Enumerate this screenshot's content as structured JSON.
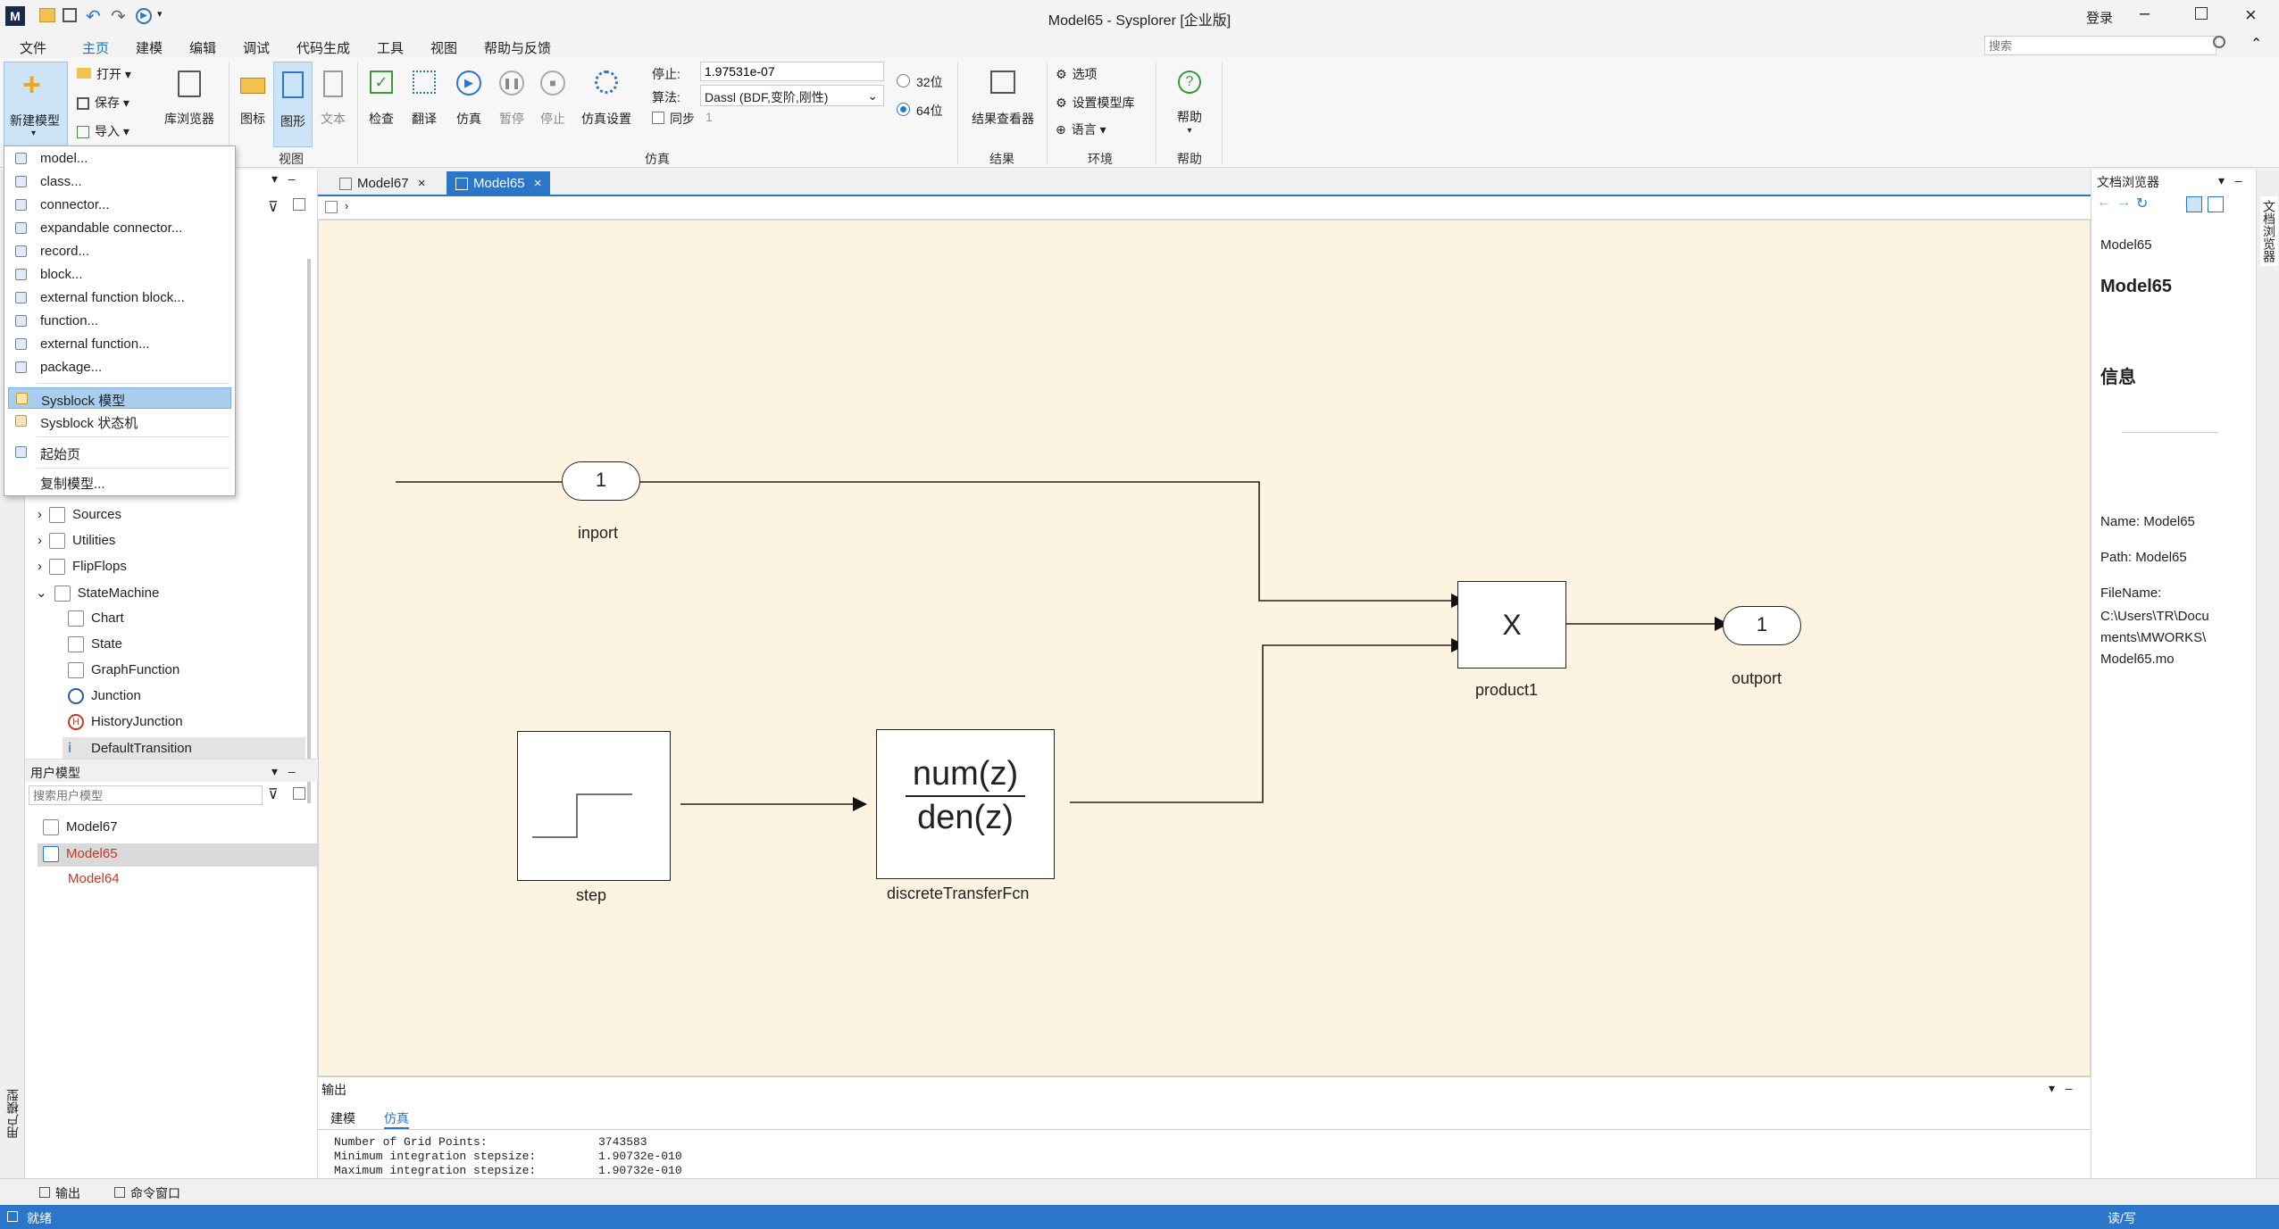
{
  "title": "Model65 - Sysplorer [企业版]",
  "titlebar": {
    "login": "登录"
  },
  "menu": [
    "文件",
    "主页",
    "建模",
    "编辑",
    "调试",
    "代码生成",
    "工具",
    "视图",
    "帮助与反馈"
  ],
  "search": {
    "placeholder": "搜索"
  },
  "ribbon": {
    "new_model": "新建模型",
    "open": "打开",
    "save": "保存",
    "import": "导入",
    "lib_browser": "库浏览器",
    "icon": "图标",
    "diagram": "图形",
    "text": "文本",
    "view_group": "视图",
    "check": "检查",
    "translate": "翻译",
    "simulate": "仿真",
    "pause": "暂停",
    "stop": "停止",
    "sim_settings": "仿真设置",
    "stop_label": "停止:",
    "stop_value": "1.97531e-07",
    "algo_label": "算法:",
    "algo_value": "Dassl (BDF,变阶,刚性)",
    "sync_label": "同步",
    "sync_value": "1",
    "bit32": "32位",
    "bit64": "64位",
    "sim_group": "仿真",
    "results_viewer": "结果查看器",
    "results_group": "结果",
    "options": "选项",
    "set_lib": "设置模型库",
    "language": "语言",
    "env_group": "环境",
    "help": "帮助",
    "help_group": "帮助"
  },
  "dropdown": {
    "items": [
      "model...",
      "class...",
      "connector...",
      "expandable connector...",
      "record...",
      "block...",
      "external function block...",
      "function...",
      "external function...",
      "package..."
    ],
    "sysblock_model": "Sysblock 模型",
    "sysblock_sm": "Sysblock 状态机",
    "start_page": "起始页",
    "copy_model": "复制模型..."
  },
  "lib_tree": {
    "items": [
      "Sources",
      "Utilities",
      "FlipFlops",
      "StateMachine"
    ],
    "children": [
      "Chart",
      "State",
      "GraphFunction",
      "Junction",
      "HistoryJunction",
      "DefaultTransition"
    ]
  },
  "user_models": {
    "header": "用户模型",
    "search_placeholder": "搜索用户模型",
    "items": [
      "Model67",
      "Model65",
      "Model64"
    ]
  },
  "left_vertical": "用户模型",
  "tabs": [
    "Model67",
    "Model65"
  ],
  "diagram": {
    "inport": {
      "value": "1",
      "label": "inport"
    },
    "outport": {
      "value": "1",
      "label": "outport"
    },
    "product": {
      "symbol": "X",
      "label": "product1"
    },
    "step": {
      "label": "step"
    },
    "tf": {
      "num": "num(z)",
      "den": "den(z)",
      "label": "discreteTransferFcn"
    }
  },
  "output": {
    "header": "输出",
    "tabs": [
      "建模",
      "仿真"
    ],
    "lines": [
      {
        "k": "Number of Grid Points:",
        "v": "3743583"
      },
      {
        "k": "Minimum integration stepsize:",
        "v": "1.90732e-010"
      },
      {
        "k": "Maximum integration stepsize:",
        "v": "1.90732e-010"
      }
    ]
  },
  "doc": {
    "header": "文档浏览器",
    "crumb": "Model65",
    "title": "Model65",
    "info": "信息",
    "name": "Name: Model65",
    "path": "Path: Model65",
    "filename_label": "FileName:",
    "filename_lines": [
      "C:\\Users\\TR\\Docu",
      "ments\\MWORKS\\",
      "Model65.mo"
    ]
  },
  "right_vertical": "文档浏览器",
  "bottom": {
    "output": "输出",
    "cmd": "命令窗口"
  },
  "status": {
    "left": "就绪",
    "right": "读/写"
  },
  "colors": {
    "accent": "#2b76c8",
    "canvas": "#fdf3e1",
    "red_model": "#c0392b"
  }
}
